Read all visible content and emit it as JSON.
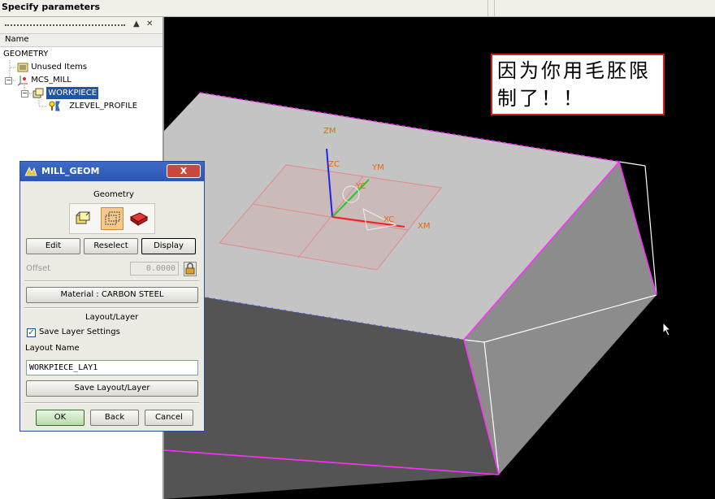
{
  "window": {
    "title": "Specify parameters"
  },
  "navigator": {
    "controls": {
      "collapse": "▲",
      "close": "✕"
    },
    "column_header": "Name",
    "tree": [
      {
        "label": "GEOMETRY",
        "level": 0
      },
      {
        "label": "Unused Items",
        "level": 1
      },
      {
        "label": "MCS_MILL",
        "level": 1
      },
      {
        "label": "WORKPIECE",
        "level": 2,
        "selected": true
      },
      {
        "label": "ZLEVEL_PROFILE",
        "level": 3
      }
    ]
  },
  "viewport": {
    "note": {
      "line1": "因为你用毛胚限",
      "line2": "制了！！"
    },
    "axes": {
      "zm": "ZM",
      "zc": "ZC",
      "ym": "YM",
      "yc": "YC",
      "xc": "XC",
      "xm": "XM"
    },
    "colors": {
      "body_top": "#c4c4c4",
      "body_side": "#545454",
      "body_right": "#8c8c8c",
      "edge": "#ff2fff",
      "axis_label": "#e8660f"
    }
  },
  "dialog": {
    "title": "MILL_GEOM",
    "close": "X",
    "geometry_label": "Geometry",
    "geometry_icons": [
      "part-geometry-icon",
      "blank-geometry-icon",
      "check-geometry-icon"
    ],
    "buttons": {
      "edit": "Edit",
      "reselect": "Reselect",
      "display": "Display"
    },
    "offset_label": "Offset",
    "offset_value": "0.0000",
    "material_button": "Material : CARBON STEEL",
    "layout_layer_label": "Layout/Layer",
    "save_layer_settings_label": "Save Layer Settings",
    "save_layer_settings_checked": true,
    "layout_name_label": "Layout Name",
    "layout_name_value": "WORKPIECE_LAY1",
    "save_layout_button": "Save Layout/Layer",
    "footer": {
      "ok": "OK",
      "back": "Back",
      "cancel": "Cancel"
    }
  }
}
